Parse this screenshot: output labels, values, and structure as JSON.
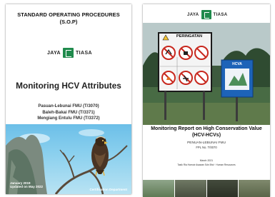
{
  "left_doc": {
    "title_line1": "STANDARD OPERATING PROCEDURES",
    "title_line2": "(S.O.P)",
    "logo_left": "JAYA",
    "logo_right": "TIASA",
    "main_title": "Monitoring HCV Attributes",
    "subtitles": [
      "Pasuan-Lebunai FMU (T/3070)",
      "Baleh-Bakai FMU (T/3371)",
      "Mengiang Entulu FMU (T/3372)"
    ],
    "date": "January 2019",
    "date_line2": "Updated on May 2022",
    "department": "Certification Department"
  },
  "right_doc": {
    "logo_left": "JAYA",
    "logo_right": "TIASA",
    "sign_title": "PERINGATAN",
    "board_label": "HCVA",
    "title_line1": "Monitoring Report on High Conservation Value",
    "title_line2": "(HCV-HCVs)",
    "subtitle_line1": "PENUAN-LEBUNAI FMU",
    "subtitle_line2": "FPL No. T/0070",
    "footer_line1": "March 2021",
    "footer_line2": "Tasik Ria Harnoir Asawan Sdn Bhd · Human Resources"
  },
  "colors": {
    "logo_green": "#1f8a4c",
    "sign_red": "#c8281e",
    "board_blue": "#1d63b8",
    "sky": "#7cc7ea",
    "forest": "#3d5a3e"
  }
}
